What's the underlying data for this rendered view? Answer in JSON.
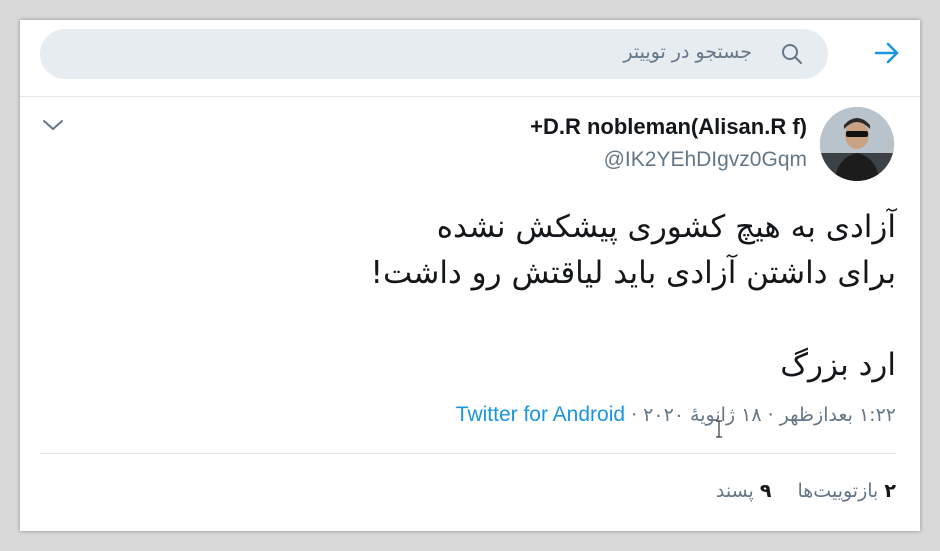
{
  "search": {
    "placeholder": "جستجو در توییتر"
  },
  "tweet": {
    "author": {
      "display_name": "+D.R nobleman(Alisan.R f)",
      "handle": "@IK2YEhDIgvz0Gqm"
    },
    "lines": [
      "آزادی به هیچ کشوری پیشکش نشده",
      "برای داشتن آزادی باید لیاقتش رو داشت!",
      "",
      "ارد بزرگ"
    ],
    "meta": {
      "time": "۱:۲۲ بعدازظهر",
      "separator": " · ",
      "date": "۱۸ ژانویهٔ ۲۰۲۰",
      "source": "Twitter for Android"
    },
    "stats": {
      "retweets_count": "۲",
      "retweets_label": "بازتوییت‌ها",
      "likes_count": "۹",
      "likes_label": "پسند"
    }
  },
  "colors": {
    "accent": "#1b95e0",
    "text": "#14171a",
    "muted": "#657786"
  },
  "icons": {
    "back": "arrow-right-icon",
    "search": "search-icon",
    "menu": "chevron-down-icon"
  }
}
